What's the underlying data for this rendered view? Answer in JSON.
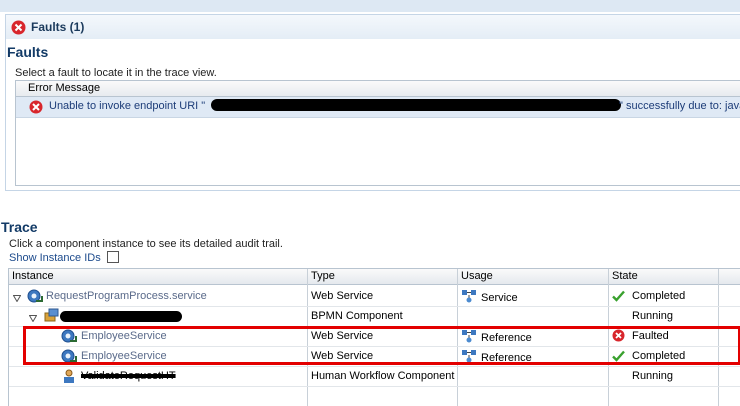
{
  "faults": {
    "header_title": "Faults (1)",
    "section_title": "Faults",
    "hint": "Select a fault to locate it in the trace view.",
    "column_header": "Error Message",
    "error_prefix": "Unable to invoke endpoint URI \"",
    "error_suffix": "\" successfully due to: javax."
  },
  "trace": {
    "section_title": "Trace",
    "hint": "Click a component instance to see its detailed audit trail.",
    "show_instance_ids_label": "Show Instance IDs",
    "columns": [
      "Instance",
      "Type",
      "Usage",
      "State"
    ],
    "rows": [
      {
        "instance": "RequestProgramProcess.service",
        "type": "Web Service",
        "usage": "Service",
        "state": "Completed"
      },
      {
        "instance": "",
        "type": "BPMN Component",
        "usage": "",
        "state": "Running"
      },
      {
        "instance": "EmployeeService",
        "type": "Web Service",
        "usage": "Reference",
        "state": "Faulted"
      },
      {
        "instance": "EmployeeService",
        "type": "Web Service",
        "usage": "Reference",
        "state": "Completed"
      },
      {
        "instance": "ValidateRequestHT",
        "type": "Human Workflow Component",
        "usage": "",
        "state": "Running"
      }
    ]
  },
  "colors": {
    "error": "#d8262c",
    "success": "#3aa12f",
    "highlight": "#e30000",
    "link": "#5a6a8a",
    "title": "#123a66"
  }
}
